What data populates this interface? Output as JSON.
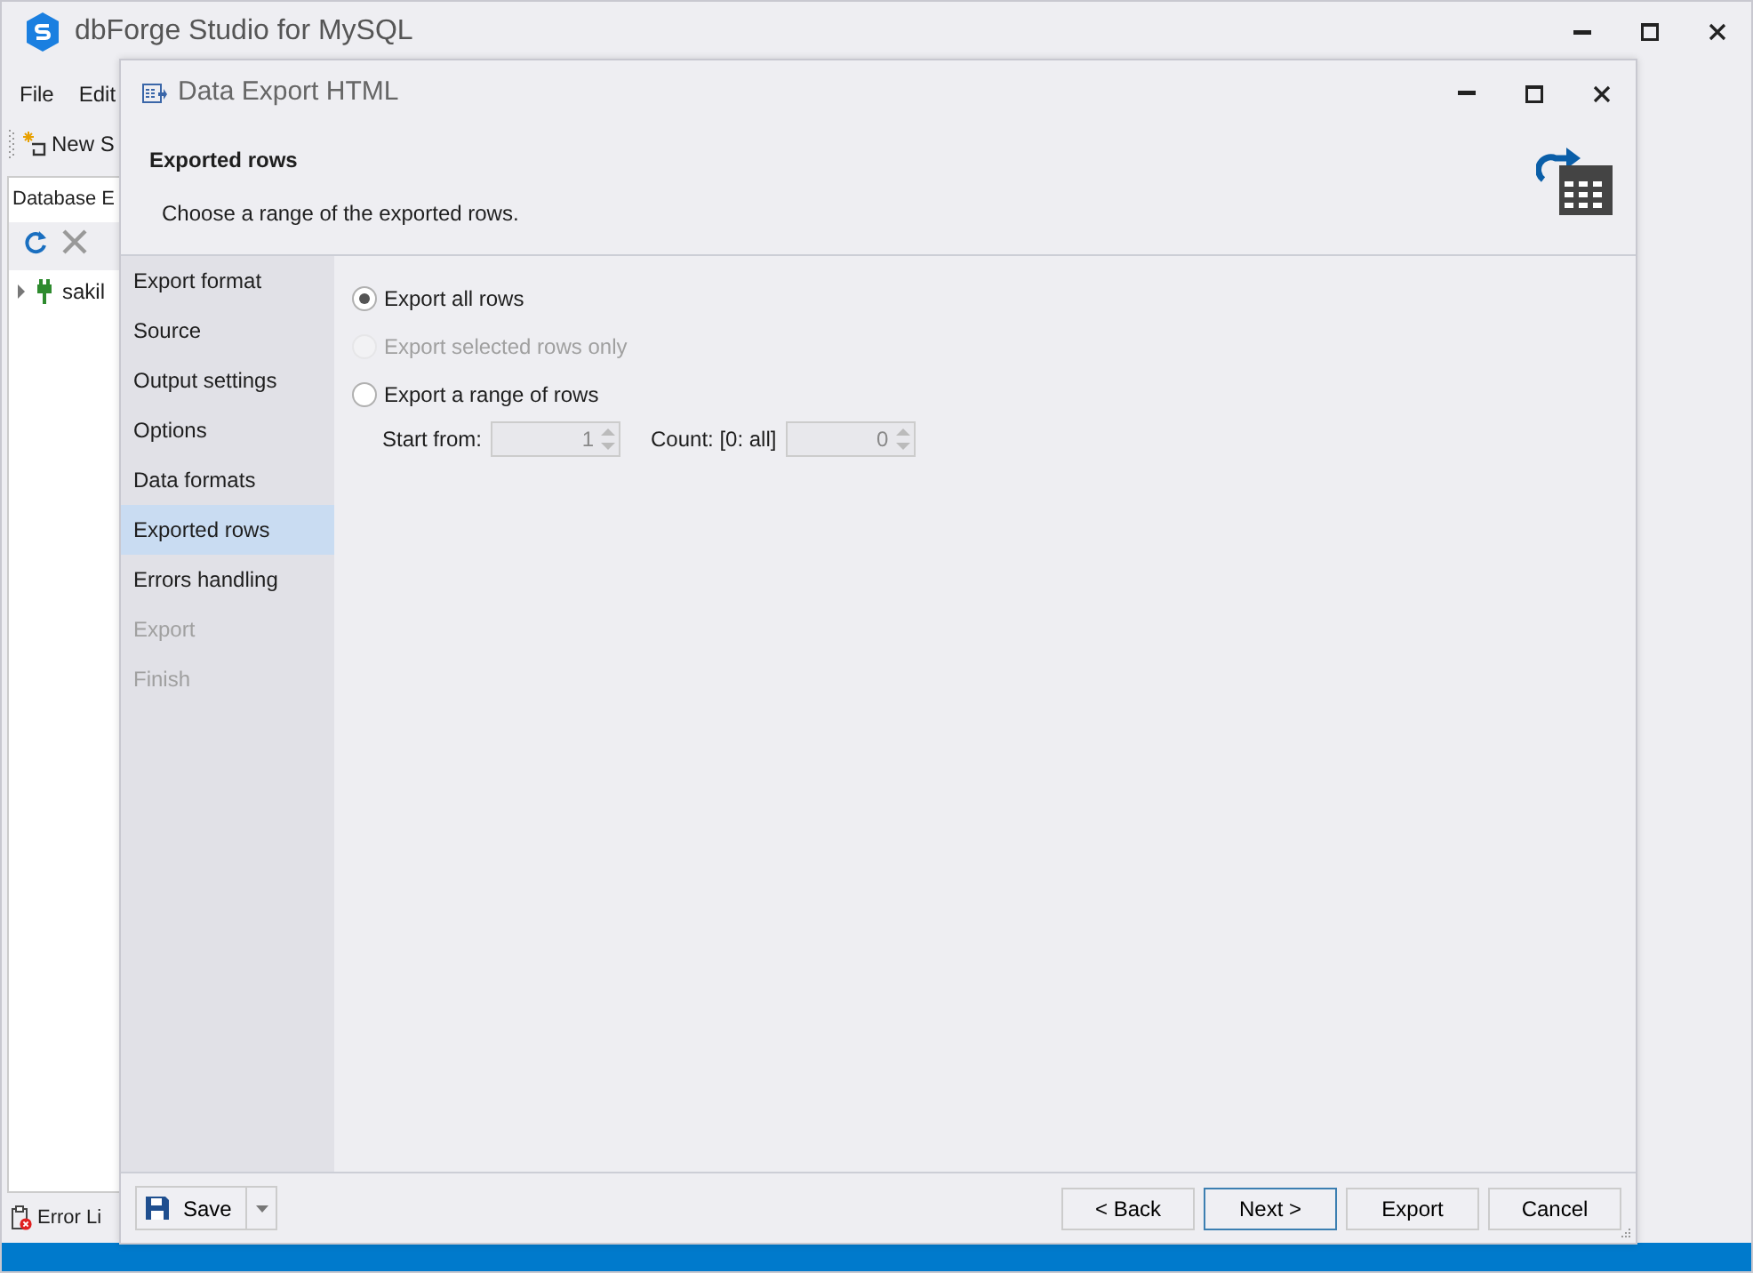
{
  "app": {
    "title": "dbForge Studio for MySQL",
    "menu": [
      "File",
      "Edit"
    ],
    "toolbar": [
      "New S"
    ],
    "panel_tab": "Database E",
    "tree": [
      {
        "label": "sakil",
        "expanded": false
      }
    ],
    "bottom_tab": "Error Li"
  },
  "dialog": {
    "title": "Data Export HTML",
    "header": {
      "title": "Exported rows",
      "subtitle": "Choose a range of the exported rows."
    },
    "steps": [
      {
        "label": "Export format",
        "selected": false,
        "disabled": false
      },
      {
        "label": "Source",
        "selected": false,
        "disabled": false
      },
      {
        "label": "Output settings",
        "selected": false,
        "disabled": false
      },
      {
        "label": "Options",
        "selected": false,
        "disabled": false
      },
      {
        "label": "Data formats",
        "selected": false,
        "disabled": false
      },
      {
        "label": "Exported rows",
        "selected": true,
        "disabled": false
      },
      {
        "label": "Errors handling",
        "selected": false,
        "disabled": false
      },
      {
        "label": "Export",
        "selected": false,
        "disabled": true
      },
      {
        "label": "Finish",
        "selected": false,
        "disabled": true
      }
    ],
    "options": [
      {
        "label": "Export all rows",
        "selected": true,
        "disabled": false
      },
      {
        "label": "Export selected rows only",
        "selected": false,
        "disabled": true
      },
      {
        "label": "Export a range of rows",
        "selected": false,
        "disabled": false
      }
    ],
    "range": {
      "start_label": "Start from:",
      "start_value": "1",
      "count_label": "Count: [0: all]",
      "count_value": "0",
      "disabled": true
    },
    "footer": {
      "save": "Save",
      "buttons": [
        {
          "label": "< Back",
          "default": false
        },
        {
          "label": "Next >",
          "default": true
        },
        {
          "label": "Export",
          "default": false
        },
        {
          "label": "Cancel",
          "default": false
        }
      ]
    }
  }
}
